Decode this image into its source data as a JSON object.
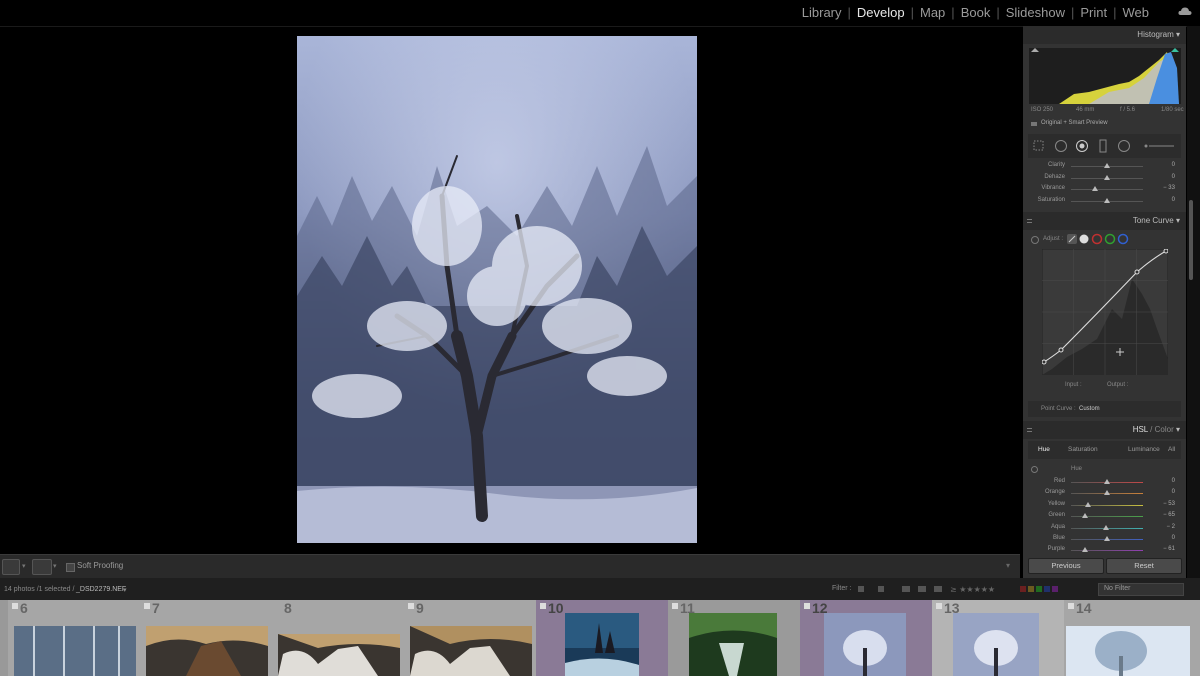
{
  "modules": {
    "library": "Library",
    "develop": "Develop",
    "map": "Map",
    "book": "Book",
    "slideshow": "Slideshow",
    "print": "Print",
    "web": "Web",
    "active": "Develop"
  },
  "histogram": {
    "title": "Histogram",
    "iso": "ISO 250",
    "focal": "46 mm",
    "aperture": "f / 5.6",
    "shutter": "1/80 sec",
    "preview": "Original + Smart Preview"
  },
  "presence": {
    "sliders": [
      {
        "label": "Clarity",
        "value": "0",
        "pos": 0.5
      },
      {
        "label": "Dehaze",
        "value": "0",
        "pos": 0.5
      },
      {
        "label": "Vibrance",
        "value": "− 33",
        "pos": 0.34
      },
      {
        "label": "Saturation",
        "value": "0",
        "pos": 0.5
      }
    ]
  },
  "tone_curve": {
    "title": "Tone Curve",
    "adjust": "Adjust :",
    "input": "Input :",
    "output": "Output :",
    "point_curve_label": "Point Curve :",
    "point_curve_value": "Custom"
  },
  "hsl": {
    "title_a": "HSL",
    "title_b": " / Color",
    "tabs": [
      "Hue",
      "Saturation",
      "Luminance",
      "All"
    ],
    "active_tab": "Hue",
    "section": "Hue",
    "sliders": [
      {
        "label": "Red",
        "value": "0",
        "pos": 0.5,
        "color": "#c04848"
      },
      {
        "label": "Orange",
        "value": "0",
        "pos": 0.5,
        "color": "#c8803a"
      },
      {
        "label": "Yellow",
        "value": "− 53",
        "pos": 0.24,
        "color": "#c8c040"
      },
      {
        "label": "Green",
        "value": "− 65",
        "pos": 0.2,
        "color": "#4aa04a"
      },
      {
        "label": "Aqua",
        "value": "− 2",
        "pos": 0.49,
        "color": "#40b0b0"
      },
      {
        "label": "Blue",
        "value": "0",
        "pos": 0.5,
        "color": "#4060c0"
      },
      {
        "label": "Purple",
        "value": "− 61",
        "pos": 0.2,
        "color": "#9040b0"
      }
    ]
  },
  "buttons": {
    "previous": "Previous",
    "reset": "Reset"
  },
  "toolbar": {
    "soft_proofing": "Soft Proofing"
  },
  "bottom_bar": {
    "count": "14 photos /1 selected /",
    "filename": "_DSD2279.NEF",
    "filter_label": "Filter :",
    "filter_value": "No Filter"
  },
  "filmstrip": {
    "cells": [
      {
        "num": "6"
      },
      {
        "num": "7"
      },
      {
        "num": "8"
      },
      {
        "num": "9"
      },
      {
        "num": "10"
      },
      {
        "num": "11"
      },
      {
        "num": "12"
      },
      {
        "num": "13"
      },
      {
        "num": "14"
      }
    ]
  },
  "colors": {
    "panel_bg": "#333333",
    "selected_cell": "#8a7a96",
    "accent_white": "#e8e8e8"
  }
}
